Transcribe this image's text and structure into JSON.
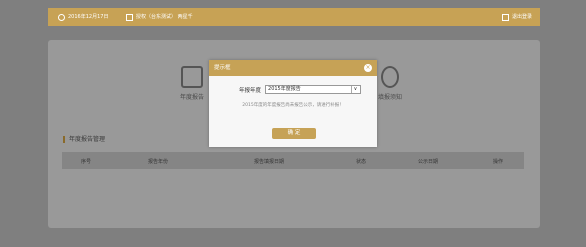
{
  "topbar": {
    "date": "2016年12月17日",
    "user": "授权（台东测试）  两星千",
    "logout": "退出登录"
  },
  "quick_links": {
    "left": "年度报告",
    "right": "填报须知"
  },
  "section_title": "年度报告管理",
  "table": {
    "headers": [
      "序号",
      "报告年份",
      "报告填报日期",
      "状态",
      "公示日期",
      "操作"
    ]
  },
  "modal": {
    "title": "提示框",
    "field_label": "年报年度",
    "select_value": "2015年度报告",
    "notice": "2015年度的年度报告尚未报告公示，请进行补报！",
    "confirm_label": "确 定",
    "close_icon": "×"
  }
}
